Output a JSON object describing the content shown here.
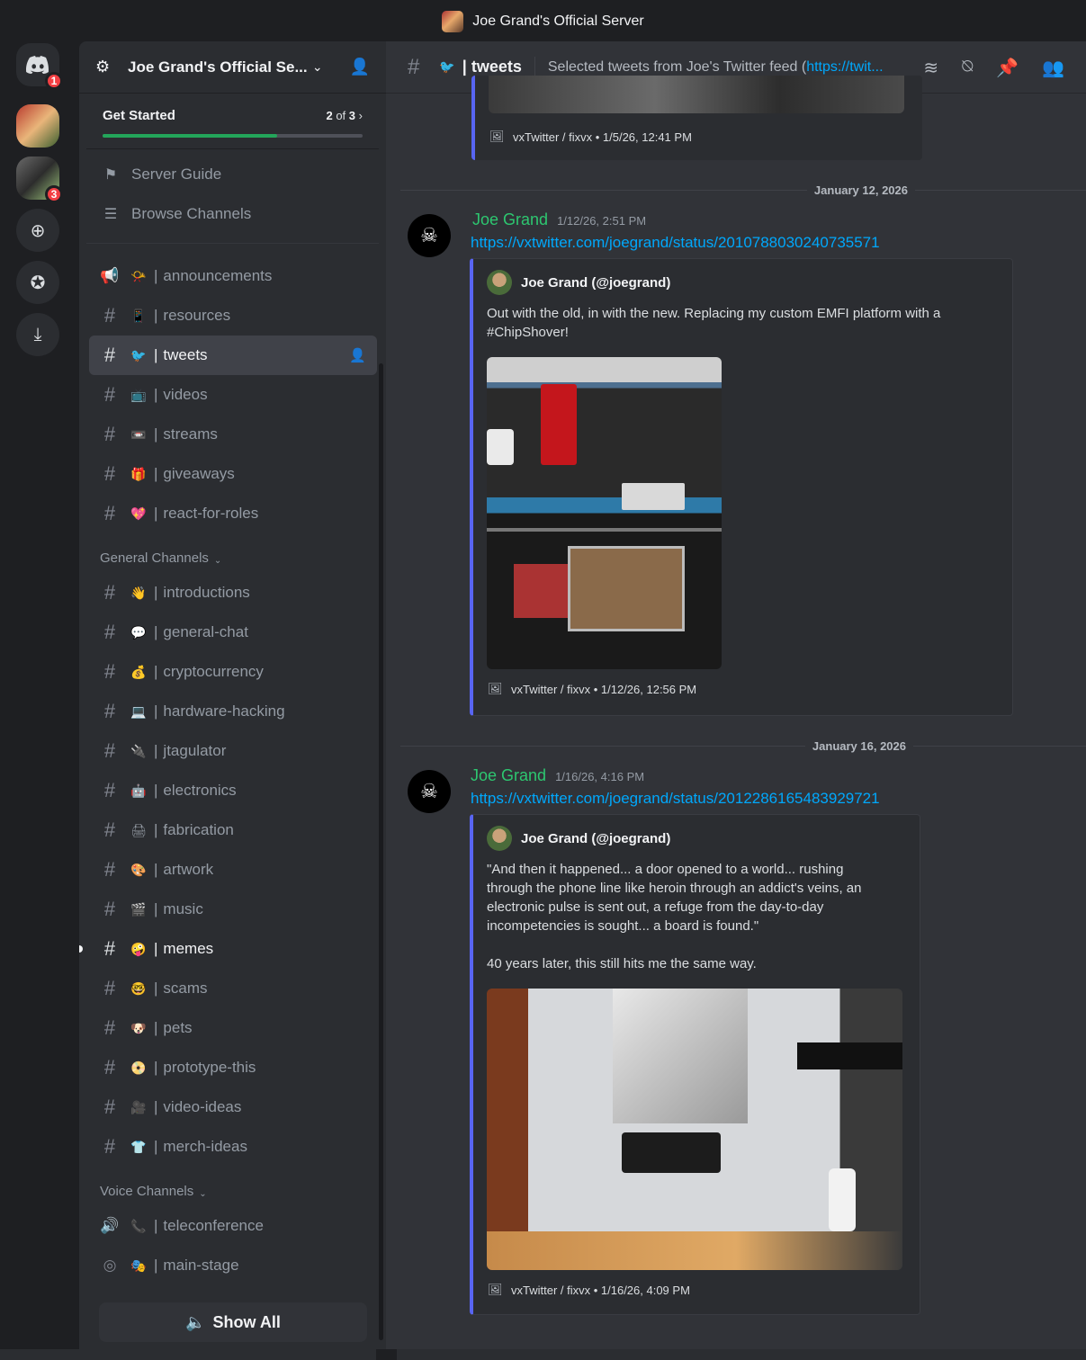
{
  "window": {
    "title": "Joe Grand's Official Server"
  },
  "rail": {
    "home_badge": "1",
    "server2_badge": "3",
    "add_server_icon": "plus-icon",
    "discover_icon": "compass-icon",
    "download_icon": "download-icon"
  },
  "server": {
    "name": "Joe Grand's Official Se...",
    "get_started": {
      "label": "Get Started",
      "progress_current": "2",
      "progress_of": "of",
      "progress_total": "3",
      "progress_fraction": 0.67
    },
    "guide_items": [
      {
        "label": "Server Guide",
        "icon": "signpost-icon"
      },
      {
        "label": "Browse Channels",
        "icon": "browse-channels-icon"
      }
    ],
    "channels": [
      {
        "name": "announcements",
        "emoji": "📯",
        "type": "announcement"
      },
      {
        "name": "resources",
        "emoji": "📱",
        "type": "text"
      },
      {
        "name": "tweets",
        "emoji": "🐦",
        "type": "text",
        "active": true
      },
      {
        "name": "videos",
        "emoji": "📺",
        "type": "text"
      },
      {
        "name": "streams",
        "emoji": "📼",
        "type": "text"
      },
      {
        "name": "giveaways",
        "emoji": "🎁",
        "type": "text"
      },
      {
        "name": "react-for-roles",
        "emoji": "💖",
        "type": "text"
      }
    ],
    "general_category": "General Channels",
    "general_channels": [
      {
        "name": "introductions",
        "emoji": "👋"
      },
      {
        "name": "general-chat",
        "emoji": "💬"
      },
      {
        "name": "cryptocurrency",
        "emoji": "💰"
      },
      {
        "name": "hardware-hacking",
        "emoji": "💻"
      },
      {
        "name": "jtagulator",
        "emoji": "🔌"
      },
      {
        "name": "electronics",
        "emoji": "🤖"
      },
      {
        "name": "fabrication",
        "emoji": "🖨"
      },
      {
        "name": "artwork",
        "emoji": "🎨"
      },
      {
        "name": "music",
        "emoji": "🎬"
      },
      {
        "name": "memes",
        "emoji": "🤪",
        "unread": true
      },
      {
        "name": "scams",
        "emoji": "🤓"
      },
      {
        "name": "pets",
        "emoji": "🐶"
      },
      {
        "name": "prototype-this",
        "emoji": "📀"
      },
      {
        "name": "video-ideas",
        "emoji": "🎥"
      },
      {
        "name": "merch-ideas",
        "emoji": "👕"
      }
    ],
    "voice_category": "Voice Channels",
    "voice_channels": [
      {
        "name": "teleconference",
        "emoji": "📞",
        "type": "voice"
      },
      {
        "name": "main-stage",
        "emoji": "🎭",
        "type": "stage"
      }
    ],
    "show_all_label": "Show All"
  },
  "channel_header": {
    "name": "tweets",
    "emoji": "🐦",
    "topic_text": "Selected tweets from Joe's Twitter feed (",
    "topic_link": "https://twit..."
  },
  "messages": {
    "previous_embed_footer": "vxTwitter / fixvx • 1/5/26, 12:41 PM",
    "date_1": "January 12, 2026",
    "msg1": {
      "author": "Joe Grand",
      "timestamp": "1/12/26, 2:51 PM",
      "url": "https://vxtwitter.com/joegrand/status/2010788030240735571",
      "embed_author": "Joe Grand (@joegrand)",
      "embed_text": "Out with the old, in with the new. Replacing my custom EMFI platform with a\n#ChipShover!",
      "embed_footer": "vxTwitter / fixvx • 1/12/26, 12:56 PM"
    },
    "date_2": "January 16, 2026",
    "msg2": {
      "author": "Joe Grand",
      "timestamp": "1/16/26, 4:16 PM",
      "url": "https://vxtwitter.com/joegrand/status/2012286165483929721",
      "embed_author": "Joe Grand (@joegrand)",
      "embed_text": "\"And then it happened... a door opened to a world... rushing\nthrough the phone line like heroin through an addict's veins, an\nelectronic pulse is sent out, a refuge from the day-to-day\nincompetencies is sought... a board is found.\"\n\n40 years later, this still hits me the same way.",
      "embed_footer": "vxTwitter / fixvx • 1/16/26, 4:09 PM"
    }
  },
  "colors": {
    "accent": "#5865f2",
    "author_name": "#2dc770",
    "link": "#00a8fc",
    "badge": "#f23f43",
    "progress": "#23a55a"
  }
}
